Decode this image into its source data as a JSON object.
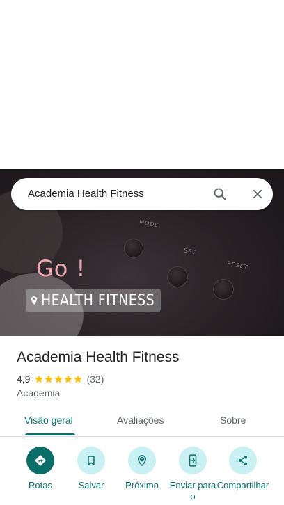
{
  "search": {
    "query": "Academia Health Fitness"
  },
  "photo": {
    "overlay_text": "Go !",
    "brand_tag": "HEALTH FITNESS"
  },
  "place": {
    "title": "Academia Health Fitness",
    "rating": "4,9",
    "stars": 5,
    "review_count": "(32)",
    "category": "Academia"
  },
  "tabs": [
    {
      "label": "Visão geral",
      "active": true
    },
    {
      "label": "Avaliações",
      "active": false
    },
    {
      "label": "Sobre",
      "active": false
    }
  ],
  "actions": [
    {
      "label": "Rotas",
      "icon": "directions-icon"
    },
    {
      "label": "Salvar",
      "icon": "bookmark-icon"
    },
    {
      "label": "Próximo",
      "icon": "nearby-icon"
    },
    {
      "label": "Enviar para o",
      "icon": "send-to-phone-icon"
    },
    {
      "label": "Compartilhar",
      "icon": "share-icon"
    }
  ],
  "colors": {
    "accent": "#0b6e69",
    "accent_light": "#c9f0f3",
    "star": "#fbbc04"
  }
}
